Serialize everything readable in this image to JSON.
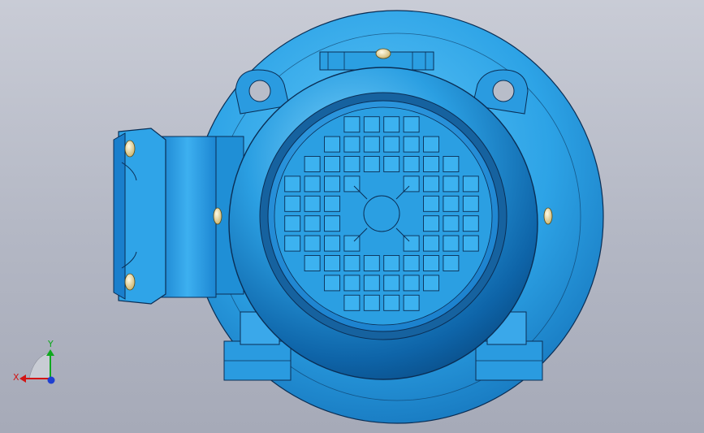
{
  "viewport": {
    "background_top": "#c9ccd6",
    "background_bottom": "#a6aab8"
  },
  "model": {
    "body_color": "#1f8fd6",
    "body_highlight": "#5cc4f7",
    "body_shadow": "#0a5a96",
    "edge_color": "#0a2e55",
    "bolt_color": "#f1e2a4",
    "fan_grid": {
      "cols": 12,
      "rows": 12
    }
  },
  "triad": {
    "x_label": "X",
    "y_label": "Y",
    "x_color": "#d21414",
    "y_color": "#0fa81e",
    "z_color": "#1f3fd1"
  }
}
